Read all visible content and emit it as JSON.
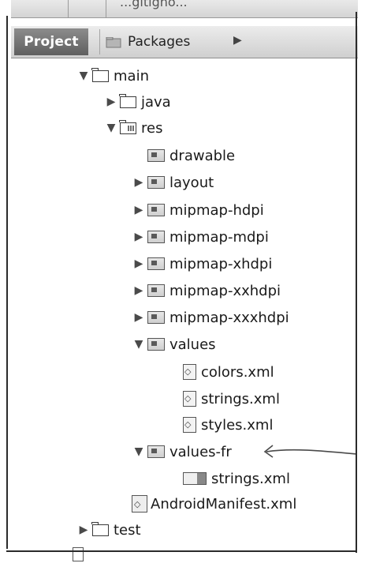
{
  "top_tabs": {
    "partial_label": "...gitigno..."
  },
  "toolbar": {
    "project_tab": "Project",
    "packages_tab": "Packages",
    "more_arrow": "▶"
  },
  "tree": [
    {
      "label": "main",
      "arrow": "▼",
      "icon": "folder-icon"
    },
    {
      "label": "java",
      "arrow": "▶",
      "icon": "folder-icon"
    },
    {
      "label": "res",
      "arrow": "▼",
      "icon": "resource-folder-icon"
    },
    {
      "label": "drawable",
      "arrow": "",
      "icon": "res-folder-icon"
    },
    {
      "label": "layout",
      "arrow": "▶",
      "icon": "res-folder-icon"
    },
    {
      "label": "mipmap-hdpi",
      "arrow": "▶",
      "icon": "res-folder-icon"
    },
    {
      "label": "mipmap-mdpi",
      "arrow": "▶",
      "icon": "res-folder-icon"
    },
    {
      "label": "mipmap-xhdpi",
      "arrow": "▶",
      "icon": "res-folder-icon"
    },
    {
      "label": "mipmap-xxhdpi",
      "arrow": "▶",
      "icon": "res-folder-icon"
    },
    {
      "label": "mipmap-xxxhdpi",
      "arrow": "▶",
      "icon": "res-folder-icon"
    },
    {
      "label": "values",
      "arrow": "▼",
      "icon": "res-folder-icon"
    },
    {
      "label": "colors.xml",
      "arrow": "",
      "icon": "xml-file-icon"
    },
    {
      "label": "strings.xml",
      "arrow": "",
      "icon": "xml-file-icon"
    },
    {
      "label": "styles.xml",
      "arrow": "",
      "icon": "xml-file-icon"
    },
    {
      "label": "values-fr",
      "arrow": "▼",
      "icon": "res-folder-icon"
    },
    {
      "label": "strings.xml",
      "arrow": "",
      "icon": "strings-file-icon"
    },
    {
      "label": "AndroidManifest.xml",
      "arrow": "",
      "icon": "manifest-file-icon"
    },
    {
      "label": "test",
      "arrow": "▶",
      "icon": "folder-icon"
    }
  ]
}
